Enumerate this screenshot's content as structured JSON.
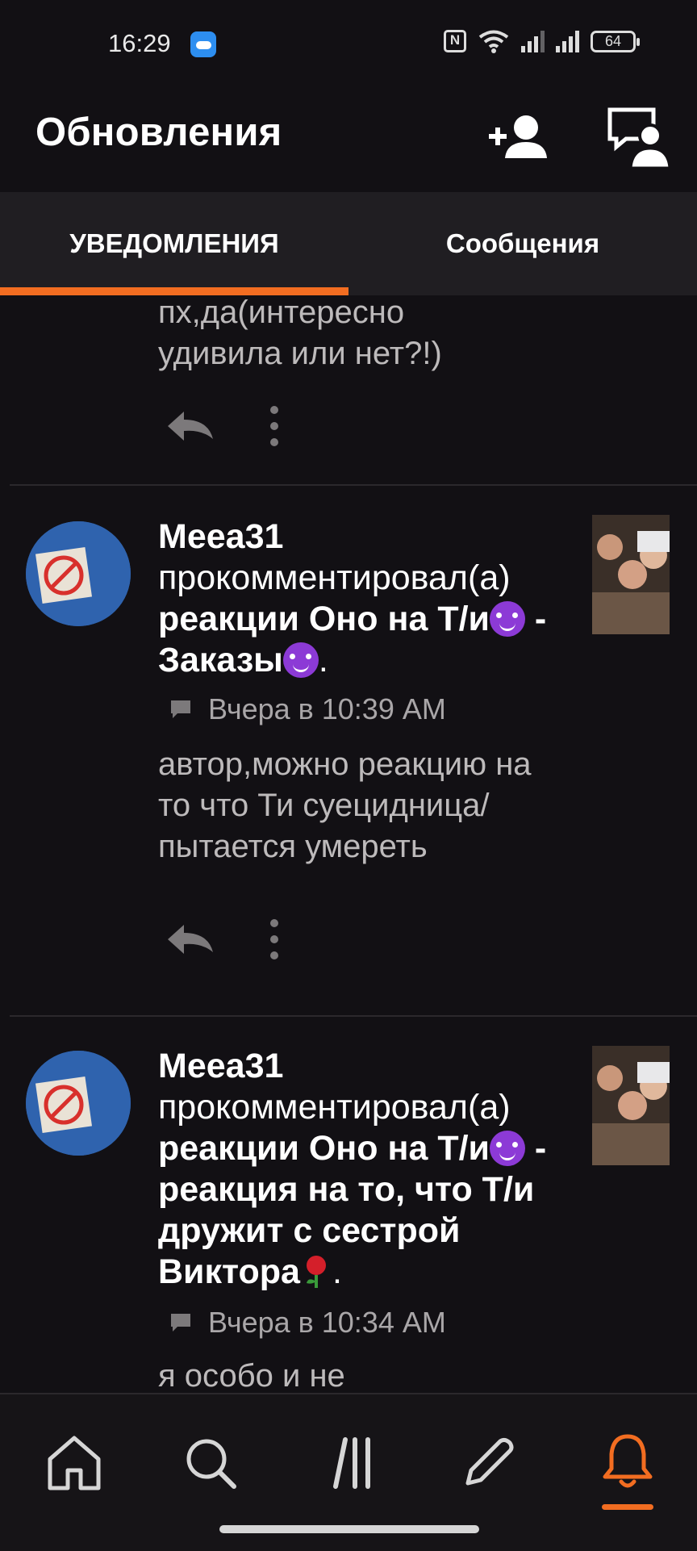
{
  "status": {
    "time": "16:29",
    "battery": "64"
  },
  "header": {
    "title": "Обновления"
  },
  "tabs": [
    {
      "label": "УВЕДОМЛЕНИЯ",
      "active": true
    },
    {
      "label": "Сообщения",
      "active": false
    }
  ],
  "feed": {
    "partial_item": {
      "text": "пх,да(интересно удивила или нет?!)"
    },
    "items": [
      {
        "user": "Meea31",
        "action": "прокомментировал(а)",
        "story_title_a": "реакции Оно на Т/и",
        "story_title_b": " - Заказы",
        "end": ".",
        "timestamp": "Вчера в 10:39 AM",
        "comment": "автор,можно реакцию на то что Ти суецидница/пытается умереть"
      },
      {
        "user": "Meea31",
        "action": "прокомментировал(а)",
        "story_title_a": "реакции Оно на Т/и",
        "story_title_b": " - реакция на то, что Т/и дружит с сестрой Виктора",
        "end": ".",
        "timestamp": "Вчера в 10:34 AM",
        "comment": "я особо и не"
      }
    ]
  },
  "icons": {
    "add_user": "add-user-icon",
    "conversation": "conversation-icon",
    "reply": "reply-icon",
    "more": "more-vertical-icon",
    "comment": "comment-icon",
    "home": "home-icon",
    "search": "search-icon",
    "library": "library-icon",
    "write": "pencil-icon",
    "notifications": "bell-icon"
  },
  "colors": {
    "accent": "#f26d21",
    "background": "#121014",
    "tabbar": "#201e22"
  }
}
